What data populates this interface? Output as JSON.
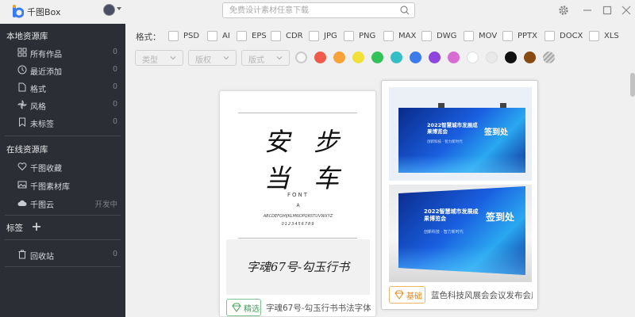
{
  "app": {
    "title": "千图Box"
  },
  "search": {
    "placeholder": "免费设计素材任意下载"
  },
  "sidebar": {
    "local_section": "本地资源库",
    "local_items": [
      {
        "label": "所有作品",
        "count": "0",
        "icon": "grid-icon"
      },
      {
        "label": "最近添加",
        "count": "0",
        "icon": "clock-icon"
      },
      {
        "label": "格式",
        "count": "0",
        "icon": "file-icon"
      },
      {
        "label": "风格",
        "count": "0",
        "icon": "pinwheel-icon"
      },
      {
        "label": "未标签",
        "count": "0",
        "icon": "bookmark-icon"
      }
    ],
    "online_section": "在线资源库",
    "online_items": [
      {
        "label": "千图收藏",
        "count": "",
        "icon": "heart-icon"
      },
      {
        "label": "千图素材库",
        "count": "",
        "icon": "image-icon"
      },
      {
        "label": "千图云",
        "count": "开发中",
        "icon": "cloud-icon"
      }
    ],
    "tags_section": "标签",
    "trash": {
      "label": "回收站",
      "count": "0",
      "icon": "trash-icon"
    }
  },
  "filters": {
    "format_label": "格式：",
    "formats": [
      "PSD",
      "AI",
      "EPS",
      "CDR",
      "JPG",
      "PNG",
      "MAX",
      "DWG",
      "MOV",
      "PPTX",
      "DOCX",
      "XLS"
    ],
    "dropdowns": [
      "类型",
      "版权",
      "版式"
    ],
    "colors": [
      "#ffffff",
      "#f05a4a",
      "#f8a23a",
      "#f2e03a",
      "#33c25a",
      "#35bfc4",
      "#3c7bea",
      "#8e46dd",
      "#d86bd4",
      "#ffffff",
      "#e9e9e9",
      "#111111",
      "#8a4a14",
      "#a8a8a8"
    ]
  },
  "cards": [
    {
      "badge": "精选",
      "title": "字魂67号-勾玉行书书法字体",
      "font_sample_line1": "安 步",
      "font_sample_line2": "当 车",
      "font_label": "FONT",
      "font_sub": "A",
      "font_alphabet": "ABCDEFGHIJKLMNOPQRSTUVWXYZ",
      "font_digits": "0123456789",
      "font_name": "字魂67号-勾玉行书"
    },
    {
      "badge": "基础",
      "title": "蓝色科技风展会会议发布会展板",
      "board_title": "2022智慧城市发展成果博览会",
      "board_sign": "签到处",
      "board_sub": "创新科技 · 智力新时代"
    }
  ],
  "colors": {
    "sidebar_bg": "#2b2e34",
    "accent_blue": "#1a4ed8"
  }
}
